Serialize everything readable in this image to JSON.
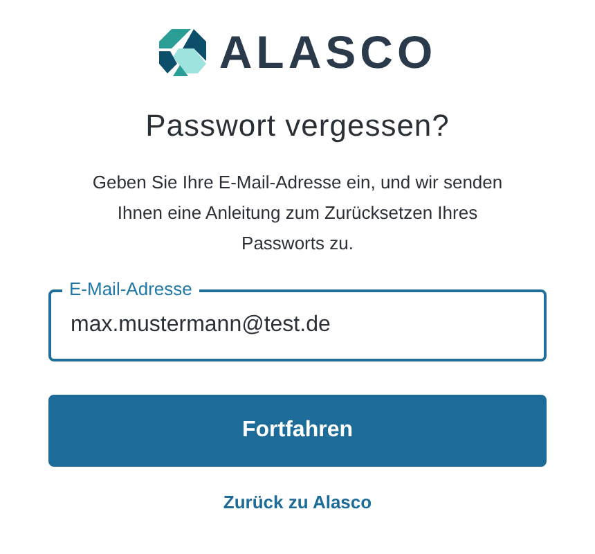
{
  "logo": {
    "text": "ALASCO"
  },
  "title": "Passwort vergessen?",
  "description": "Geben Sie Ihre E-Mail-Adresse ein, und wir senden Ihnen eine Anleitung zum Zurücksetzen Ihres Passworts zu.",
  "email_field": {
    "label": "E-Mail-Adresse",
    "value": "max.mustermann@test.de"
  },
  "submit_button": "Fortfahren",
  "back_link": "Zurück zu Alasco"
}
